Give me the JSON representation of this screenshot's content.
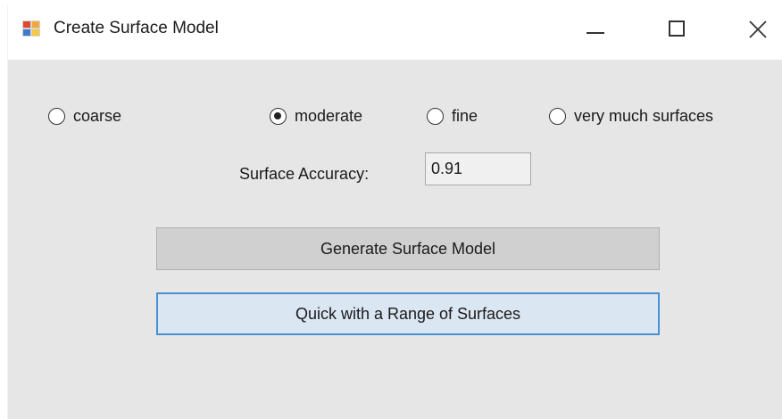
{
  "window": {
    "title": "Create Surface Model",
    "icon": "application-icon",
    "controls": {
      "minimize": "minimize-icon",
      "maximize": "maximize-icon",
      "close": "close-icon"
    }
  },
  "mesh_options": {
    "selected": "moderate",
    "options": [
      {
        "id": "coarse",
        "label": "coarse",
        "checked": false
      },
      {
        "id": "moderate",
        "label": "moderate",
        "checked": true
      },
      {
        "id": "fine",
        "label": "fine",
        "checked": false
      },
      {
        "id": "very_much",
        "label": "very much surfaces",
        "checked": false
      }
    ]
  },
  "accuracy": {
    "label": "Surface Accuracy:",
    "value": "0.91"
  },
  "buttons": {
    "generate": "Generate Surface Model",
    "quick": "Quick with a Range of Surfaces"
  },
  "colors": {
    "window_bg": "#e6e6e6",
    "titlebar_bg": "#ffffff",
    "focused_button_border": "#4a8fd4",
    "focused_button_bg": "#dbe6f3"
  }
}
